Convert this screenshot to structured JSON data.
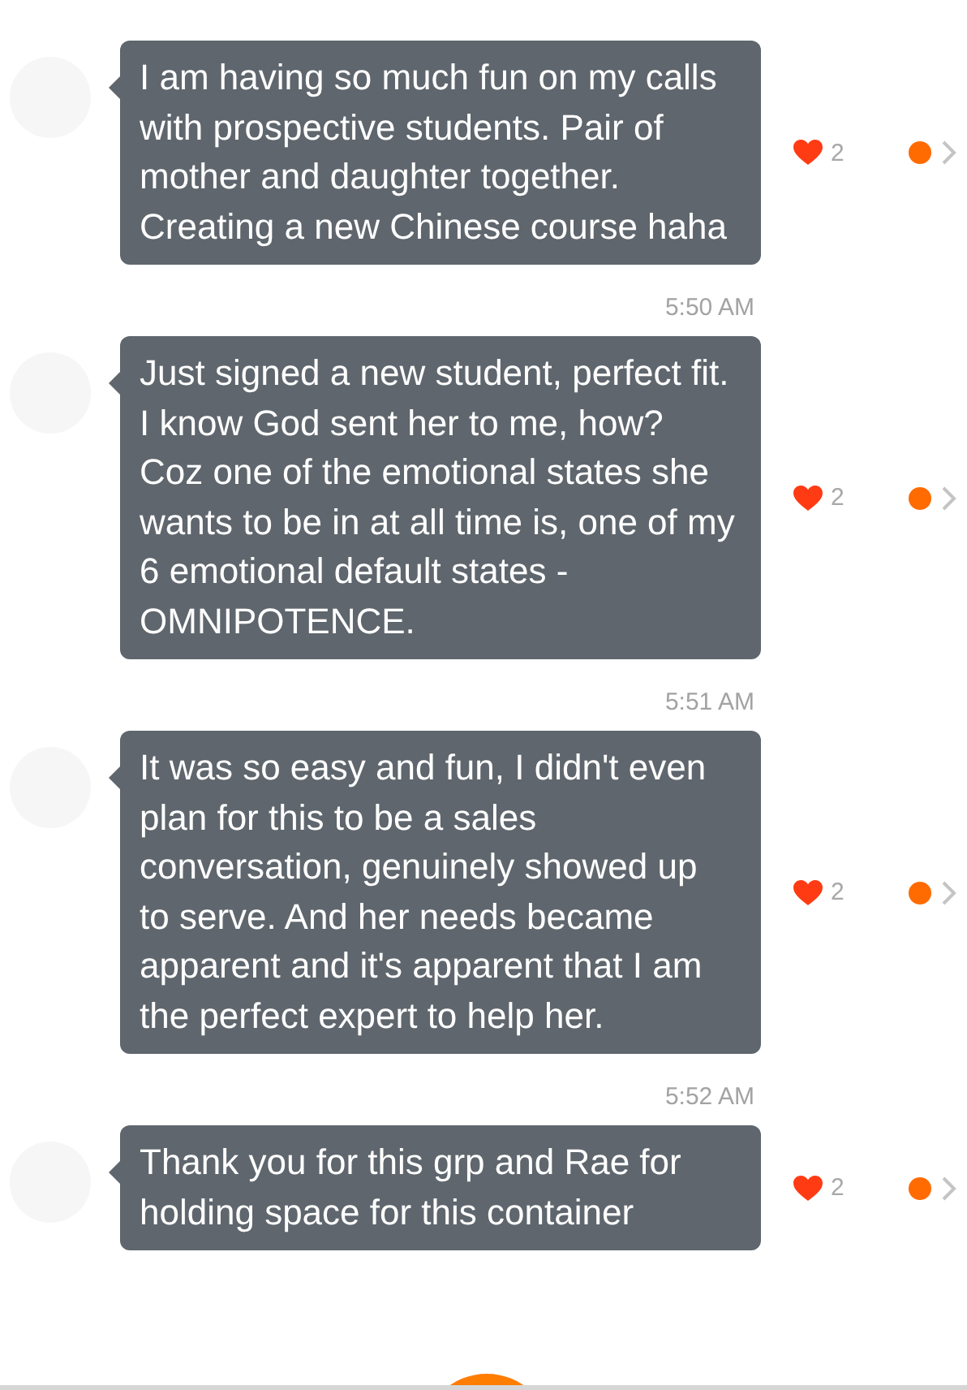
{
  "messages": [
    {
      "text": "I am having so much fun on my calls with prospective students. Pair of mother and daughter together. Creating a new Chinese course haha",
      "liked": true,
      "likes": "2"
    },
    {
      "time": "5:50 AM",
      "text": "Just signed a new student, perfect fit. I know God sent her to me, how? Coz one of the emotional states she wants to be in at all time is, one of my 6 emotional default states - OMNIPOTENCE.",
      "liked": true,
      "likes": "2"
    },
    {
      "time": "5:51 AM",
      "text": "It was so easy and fun, I didn't even plan for this to be a sales conversation, genuinely showed up to serve. And her needs became apparent and it's apparent that I am the perfect expert to help her.",
      "liked": true,
      "likes": "2"
    },
    {
      "time": "5:52 AM",
      "text": "Thank you for this grp and Rae for holding space for this container",
      "liked": true,
      "likes": "2"
    }
  ]
}
